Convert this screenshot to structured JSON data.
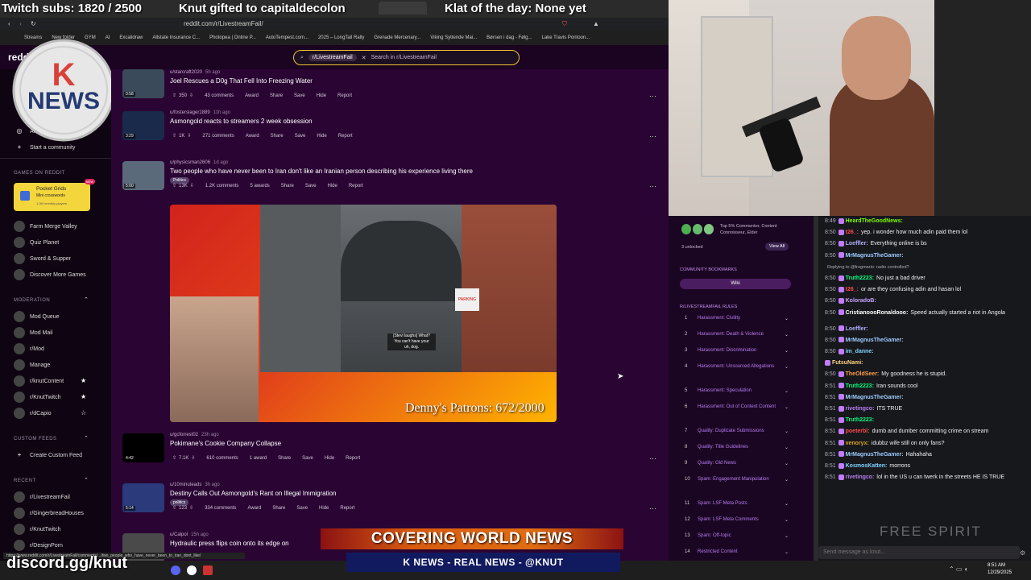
{
  "overlay": {
    "subs_text": "Twitch subs: 1820 / 2500",
    "gifted_text": "Knut gifted to capitaldecolon",
    "klat_text": "Klat of the day: None yet",
    "logo_text": "NEWS",
    "discord": "discord.gg/knut",
    "banner_main": "COVERING WORLD NEWS",
    "banner_sub": "K NEWS - REAL NEWS - @KNUT",
    "patrons": "Denny's Patrons: 672/2000",
    "watermark": "FREE SPIRIT"
  },
  "browser": {
    "url": "reddit.com/r/LivestreamFail/",
    "status_url": "https://www.reddit.com/r/LivestreamFail/comments/.../two_people_who_have_never_been_to_iran_dont_like/",
    "bookmarks": [
      "Streams",
      "New folder",
      "GYM",
      "AI",
      "Excalidraw",
      "Allstate Insurance C...",
      "Photopea | Online P...",
      "AutoTempest.com...",
      "2025 – LongTail Rally",
      "Grenade Mercenary...",
      "Viking Syttende Mai...",
      "Børsen i dag - Følg...",
      "Lake Travis Pontoon..."
    ]
  },
  "search": {
    "chip": "r/LivestreamFail",
    "placeholder": "Search in r/LivestreamFail"
  },
  "sidebar": {
    "logo": "reddit",
    "all": "All",
    "start_community": "Start a community",
    "games_heading": "GAMES ON REDDIT",
    "pocket_title": "Pocket Grids",
    "pocket_sub": "Mini crosswords",
    "pocket_players": "1.0M monthly players",
    "pocket_badge": "NEW",
    "games": [
      "Farm Merge Valley",
      "Quiz Planet",
      "Sword & Supper",
      "Discover More Games"
    ],
    "moderation_heading": "MODERATION",
    "moderation": [
      "Mod Queue",
      "Mod Mail",
      "r/Mod",
      "Manage",
      "r/knutContent",
      "r/KnutTwitch",
      "r/dCapio"
    ],
    "custom_heading": "CUSTOM FEEDS",
    "create_feed": "Create Custom Feed",
    "recent_heading": "RECENT",
    "recent": [
      "r/LivestreamFail",
      "r/GingerbreadHouses",
      "r/KnutTwitch",
      "r/DesignPorn"
    ]
  },
  "posts": [
    {
      "user": "u/starcraft2020",
      "age": "5h ago",
      "title": "Joel Rescues a D0g That Fell Into Freezing Water",
      "votes": "350",
      "comments": "43 comments",
      "dur": "0:58"
    },
    {
      "user": "u/fosterslager1889",
      "age": "11h ago",
      "title": "Asmongold reacts to streamers 2 week obsession",
      "votes": "1K",
      "comments": "271 comments",
      "dur": "3:29"
    },
    {
      "user": "u/physicsman2606",
      "age": "1d ago",
      "title": "Two people who have never been to Iran don't like an Iranian person describing his experience living there",
      "votes": "13K",
      "comments": "1.2K comments",
      "awards": "5 awards",
      "flair": "Politics",
      "dur": "5:00"
    },
    {
      "user": "u/gcforrest02",
      "age": "23h ago",
      "title": "Pokimane's Cookie Company Collapse",
      "votes": "7.1K",
      "comments": "610 comments",
      "awards": "1 award",
      "dur": "4:42"
    },
    {
      "user": "u/10minuteads",
      "age": "3h ago",
      "title": "Destiny Calls Out Asmongold's Rant on Illegal Immigration",
      "votes": "123",
      "comments": "334 comments",
      "flair": "politics",
      "dur": "5:14"
    },
    {
      "user": "u/Calpol",
      "age": "15h ago",
      "title": "Hydraulic press flips coin onto its edge on"
    }
  ],
  "actions": {
    "award": "Award",
    "share": "Share",
    "save": "Save",
    "hide": "Hide",
    "report": "Report"
  },
  "video": {
    "caption_lines": [
      "[Stevi laughs] What?",
      "You can't have your",
      "uh, dog."
    ],
    "parking_sign": "PARKING"
  },
  "right_sidebar": {
    "achievements": "Top 5% Commenter, Content Connoisseur, Elder",
    "unlocked": "3 unlocked",
    "view_all": "View All",
    "bookmarks_heading": "COMMUNITY BOOKMARKS",
    "wiki": "Wiki",
    "rules_heading": "R/LIVESTREAMFAIL RULES",
    "rules": [
      {
        "n": "1",
        "text": "Harassment: Civility"
      },
      {
        "n": "2",
        "text": "Harassment: Death & Violence"
      },
      {
        "n": "3",
        "text": "Harassment: Discrimination"
      },
      {
        "n": "4",
        "text": "Harassment: Unsourced Allegations"
      },
      {
        "n": "5",
        "text": "Harassment: Speculation"
      },
      {
        "n": "6",
        "text": "Harassment: Out of Context Content"
      },
      {
        "n": "7",
        "text": "Quality: Duplicate Submissions"
      },
      {
        "n": "8",
        "text": "Quality: Title Guidelines"
      },
      {
        "n": "9",
        "text": "Quality: Old News"
      },
      {
        "n": "10",
        "text": "Spam: Engagement Manipulation"
      },
      {
        "n": "11",
        "text": "Spam: LSF Meta Posts"
      },
      {
        "n": "12",
        "text": "Spam: LSF Meta Comments"
      },
      {
        "n": "13",
        "text": "Spam: Off-topic"
      },
      {
        "n": "14",
        "text": "Restricted Content"
      }
    ]
  },
  "chat": {
    "lines": [
      {
        "t": "8:49",
        "user": "HeardTheGoodNews:",
        "color": "#7cfc00",
        "msg": ""
      },
      {
        "t": "8:50",
        "user": "t26_:",
        "color": "#ff4b4b",
        "msg": "yep. i wonder how much adin paid them lol"
      },
      {
        "t": "8:50",
        "user": "Loeffler:",
        "color": "#b0b0ff",
        "msg": "Everything online is bs"
      },
      {
        "t": "8:50",
        "user": "MrMagnusTheGamer:",
        "color": "#9ecbff",
        "msg": ""
      },
      {
        "t": "",
        "user": "",
        "color": "#adadb8",
        "msg": "Replying to @frogmario: radio controlled?"
      },
      {
        "t": "8:50",
        "user": "Truth2223:",
        "color": "#00ff7f",
        "msg": "No just a bad driver"
      },
      {
        "t": "8:50",
        "user": "t26_:",
        "color": "#ff4b4b",
        "msg": "or are they confusing adin and hasan lol"
      },
      {
        "t": "8:50",
        "user": "KoloradoB:",
        "color": "#c8a2ff",
        "msg": ""
      },
      {
        "t": "8:50",
        "user": "CristianoooRonaldooo:",
        "color": "#ffffff",
        "msg": "Speed actually started a riot in Angola"
      },
      {
        "t": "8:50",
        "user": "Loeffler:",
        "color": "#b0b0ff",
        "msg": ""
      },
      {
        "t": "8:50",
        "user": "MrMagnusTheGamer:",
        "color": "#9ecbff",
        "msg": ""
      },
      {
        "t": "8:50",
        "user": "im_danne:",
        "color": "#7fd4ff",
        "msg": ""
      },
      {
        "t": "",
        "user": "FutsuNami:",
        "color": "#ffd27f",
        "msg": ""
      },
      {
        "t": "8:50",
        "user": "TheOldSeer:",
        "color": "#ff9f4a",
        "msg": "My goodness he is stupid."
      },
      {
        "t": "8:51",
        "user": "Truth2223:",
        "color": "#00ff7f",
        "msg": "Iran sounds cool"
      },
      {
        "t": "8:51",
        "user": "MrMagnusTheGamer:",
        "color": "#9ecbff",
        "msg": ""
      },
      {
        "t": "8:51",
        "user": "rivetingco:",
        "color": "#b77cf0",
        "msg": "ITS TRUE"
      },
      {
        "t": "8:51",
        "user": "Truth2223:",
        "color": "#00ff7f",
        "msg": ""
      },
      {
        "t": "8:51",
        "user": "poeterbl:",
        "color": "#ff4b4b",
        "msg": "dumb and dumber committing crime on stream"
      },
      {
        "t": "8:51",
        "user": "venoryx:",
        "color": "#daa520",
        "msg": "idubbz wife still on only fans?"
      },
      {
        "t": "8:51",
        "user": "MrMagnusTheGamer:",
        "color": "#9ecbff",
        "msg": "Hahahaha"
      },
      {
        "t": "8:51",
        "user": "KosmosKatten:",
        "color": "#7fd4ff",
        "msg": "morrons"
      },
      {
        "t": "8:51",
        "user": "rivetingco:",
        "color": "#b77cf0",
        "msg": "lol in the US u can twerk in the streets HE IS TRUE"
      }
    ],
    "input_placeholder": "Send message as knut..."
  },
  "taskbar": {
    "time": "8:51 AM",
    "date": "12/29/2025"
  }
}
